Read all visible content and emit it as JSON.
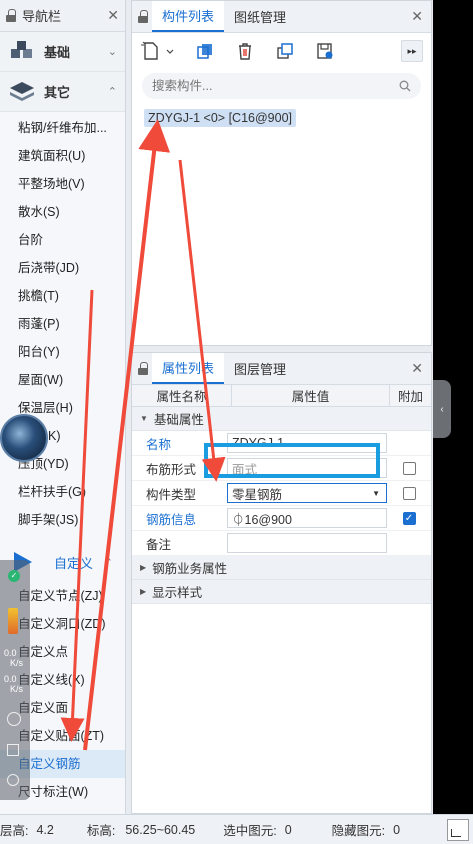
{
  "nav": {
    "title": "导航栏",
    "groups": [
      {
        "label": "基础"
      },
      {
        "label": "其它"
      }
    ],
    "items": [
      "粘钢/纤维布加...",
      "建筑面积(U)",
      "平整场地(V)",
      "散水(S)",
      "台阶",
      "后浇带(JD)",
      "挑檐(T)",
      "雨蓬(P)",
      "阳台(Y)",
      "屋面(W)",
      "保温层(H)",
      "K)",
      "压顶(YD)",
      "栏杆扶手(G)",
      "脚手架(JS)"
    ],
    "custom_group": "自定义",
    "custom_items": [
      "自定义节点(ZJ)",
      "自定义洞口(ZD)",
      "自定义点",
      "自定义线(X)",
      "自定义面",
      "自定义贴面(ZT)",
      "自定义钢筋",
      "尺寸标注(W)"
    ]
  },
  "component_panel": {
    "tabs": [
      "构件列表",
      "图纸管理"
    ],
    "search_placeholder": "搜索构件...",
    "selected_item": "ZDYGJ-1 <0> [C16@900]"
  },
  "property_panel": {
    "tabs": [
      "属性列表",
      "图层管理"
    ],
    "columns": [
      "属性名称",
      "属性值",
      "附加"
    ],
    "section_basic": "基础属性",
    "rows": [
      {
        "name": "名称",
        "value": "ZDYGJ-1",
        "link": true
      },
      {
        "name": "布筋形式",
        "value": "面式",
        "link": false
      },
      {
        "name": "构件类型",
        "value": "零星钢筋",
        "link": false
      },
      {
        "name": "钢筋信息",
        "value": "⏀16@900",
        "link": true
      },
      {
        "name": "备注",
        "value": "",
        "link": false
      }
    ],
    "section_business": "钢筋业务属性",
    "section_display": "显示样式"
  },
  "float_widget": {
    "up_speed": "0.0",
    "up_unit": "K/s",
    "down_speed": "0.0",
    "down_unit": "K/s"
  },
  "status": {
    "floor_label": "层高:",
    "floor_value": "4.2",
    "elev_label": "标高:",
    "elev_value": "56.25~60.45",
    "selected_label": "选中图元:",
    "selected_value": "0",
    "hidden_label": "隐藏图元:",
    "hidden_value": "0"
  },
  "colors": {
    "accent": "#1a6fd1",
    "arrow": "#f04a3a",
    "highlight_box": "#1a9ce0"
  }
}
